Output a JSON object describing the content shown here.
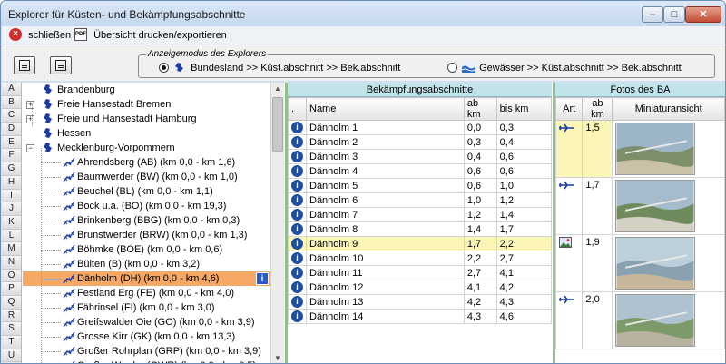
{
  "window": {
    "title": "Explorer für Küsten- und Bekämpfungsabschnitte",
    "min_symbol": "–",
    "max_symbol": "□",
    "close_symbol": "✕"
  },
  "toolbar": {
    "close_label": "schließen",
    "print_label": "Übersicht drucken/exportieren"
  },
  "modebar": {
    "legend": "Anzeigemodus des Explorers",
    "option_bundesland": "Bundesland >> Küst.abschnitt >> Bek.abschnitt",
    "option_gewaesser": "Gewässer >> Küst.abschnitt >> Bek.abschnitt",
    "selected": "bundesland"
  },
  "alphabet": [
    "A",
    "B",
    "C",
    "D",
    "E",
    "F",
    "G",
    "H",
    "I",
    "J",
    "K",
    "L",
    "M",
    "N",
    "O",
    "P",
    "Q",
    "R",
    "S",
    "T",
    "U"
  ],
  "tree": {
    "states": [
      {
        "label": "Brandenburg",
        "expander": ""
      },
      {
        "label": "Freie Hansestadt Bremen",
        "expander": "+"
      },
      {
        "label": "Freie und Hansestadt Hamburg",
        "expander": "+"
      },
      {
        "label": "Hessen",
        "expander": ""
      },
      {
        "label": "Mecklenburg-Vorpommern",
        "expander": "−"
      }
    ],
    "sections": [
      "Ahrendsberg (AB) (km 0,0 - km 1,6)",
      "Baumwerder (BW) (km 0,0 - km 1,0)",
      "Beuchel (BL) (km 0,0 - km 1,1)",
      "Bock u.a. (BO) (km 0,0 - km 19,3)",
      "Brinkenberg (BBG) (km 0,0 - km 0,3)",
      "Brunstwerder (BRW) (km 0,0 - km 1,3)",
      "Böhmke (BOE) (km 0,0 - km 0,6)",
      "Bülten (B) (km 0,0 - km 3,2)",
      "Dänholm (DH) (km 0,0 - km 4,6)",
      "Festland Erg (FE) (km 0,0 - km 4,0)",
      "Fährinsel (FI) (km 0,0 - km 3,0)",
      "Greifswalder Oie (GO) (km 0,0 - km 3,9)",
      "Grosse Kirr (GK) (km 0,0 - km 13,3)",
      "Großer Rohrplan (GRP) (km 0,0 - km 3,9)",
      "Großer Werder (GWR) (km 0,0 - km 0,5)"
    ],
    "selected_section_index": 8,
    "info_label": "i"
  },
  "ba_panel": {
    "title": "Bekämpfungsabschnitte",
    "columns": [
      ".",
      "Name",
      "ab km",
      "bis km"
    ],
    "info_label": "i",
    "highlight_index": 8,
    "rows": [
      [
        "Dänholm 1",
        "0,0",
        "0,3"
      ],
      [
        "Dänholm 2",
        "0,3",
        "0,4"
      ],
      [
        "Dänholm 3",
        "0,4",
        "0,6"
      ],
      [
        "Dänholm 4",
        "0,6",
        "0,6"
      ],
      [
        "Dänholm 5",
        "0,6",
        "1,0"
      ],
      [
        "Dänholm 6",
        "1,0",
        "1,2"
      ],
      [
        "Dänholm 7",
        "1,2",
        "1,4"
      ],
      [
        "Dänholm 8",
        "1,4",
        "1,7"
      ],
      [
        "Dänholm 9",
        "1,7",
        "2,2"
      ],
      [
        "Dänholm 10",
        "2,2",
        "2,7"
      ],
      [
        "Dänholm 11",
        "2,7",
        "4,1"
      ],
      [
        "Dänholm 12",
        "4,1",
        "4,2"
      ],
      [
        "Dänholm 13",
        "4,2",
        "4,3"
      ],
      [
        "Dänholm 14",
        "4,3",
        "4,6"
      ]
    ]
  },
  "foto_panel": {
    "title": "Fotos des BA",
    "columns": [
      "Art",
      "ab km",
      "Miniaturansicht"
    ],
    "rows": [
      {
        "type": "plane-icon",
        "km": "1,5",
        "highlight": true
      },
      {
        "type": "plane-icon",
        "km": "1,7",
        "highlight": false
      },
      {
        "type": "photo-icon",
        "km": "1,9",
        "highlight": false
      },
      {
        "type": "plane-icon",
        "km": "2,0",
        "highlight": false
      }
    ]
  }
}
